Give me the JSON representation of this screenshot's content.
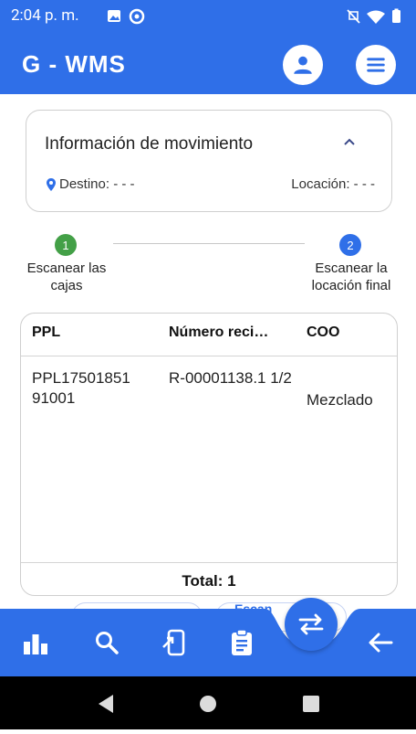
{
  "status_bar": {
    "time": "2:04 p. m.",
    "left_icons": [
      "image-icon",
      "sync-icon"
    ],
    "right_icons": [
      "mute-icon",
      "wifi-icon",
      "battery-icon"
    ]
  },
  "app_bar": {
    "title": "G - WMS",
    "profile_icon": "person-icon",
    "menu_icon": "menu-icon",
    "color": "#2f6fe8"
  },
  "info_card": {
    "title": "Información de movimiento",
    "destino": "Destino: - - -",
    "locacion": "Locación: - - -",
    "chevron_icon": "chevron-up-icon"
  },
  "stepper": {
    "steps": [
      {
        "number": "1",
        "label": "Escanear las cajas",
        "color": "#43a047"
      },
      {
        "number": "2",
        "label": "Escanear la locación final",
        "color": "#2f6fe8"
      }
    ]
  },
  "table": {
    "headers": [
      "PPL",
      "Número reci…",
      "COO"
    ],
    "rows": [
      {
        "ppl": "PPL17501851 91001",
        "numero": "R-00001138.1 1/2",
        "coo": "Mezclado"
      }
    ],
    "total": "Total: 1"
  },
  "partial_buttons": {
    "right_label": "Escan"
  },
  "bottom_nav": {
    "items": [
      "chart-icon",
      "search-icon",
      "device-transfer-icon",
      "clipboard-icon",
      "swap-icon",
      "arrow-back-icon"
    ]
  },
  "system_nav": [
    "back-icon",
    "home-icon",
    "recents-icon"
  ]
}
